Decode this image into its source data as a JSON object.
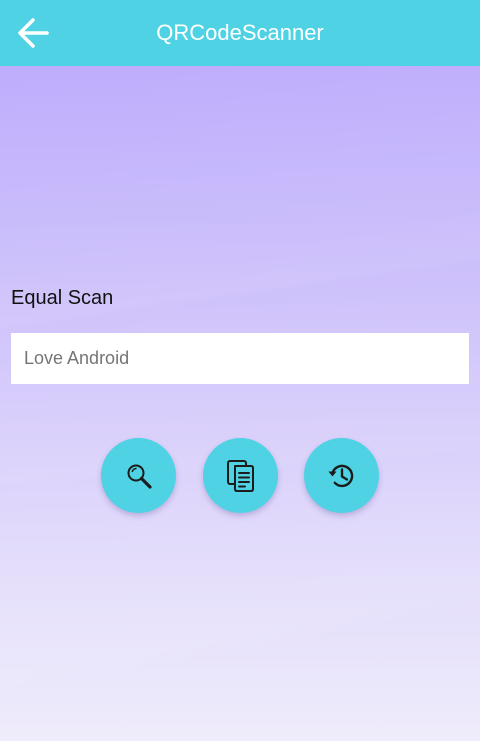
{
  "toolbar": {
    "title": "QRCodeScanner",
    "back_icon": "arrow-back-icon",
    "background_color": "#4fd2e4"
  },
  "content": {
    "label": "Equal Scan",
    "input": {
      "value": "Love Android",
      "placeholder": ""
    }
  },
  "actions": [
    {
      "icon": "search-icon"
    },
    {
      "icon": "document-copy-icon"
    },
    {
      "icon": "history-icon"
    }
  ],
  "colors": {
    "accent": "#4fd2e4",
    "background_top": "#b9a6fd",
    "background_bottom": "#efecfb"
  }
}
